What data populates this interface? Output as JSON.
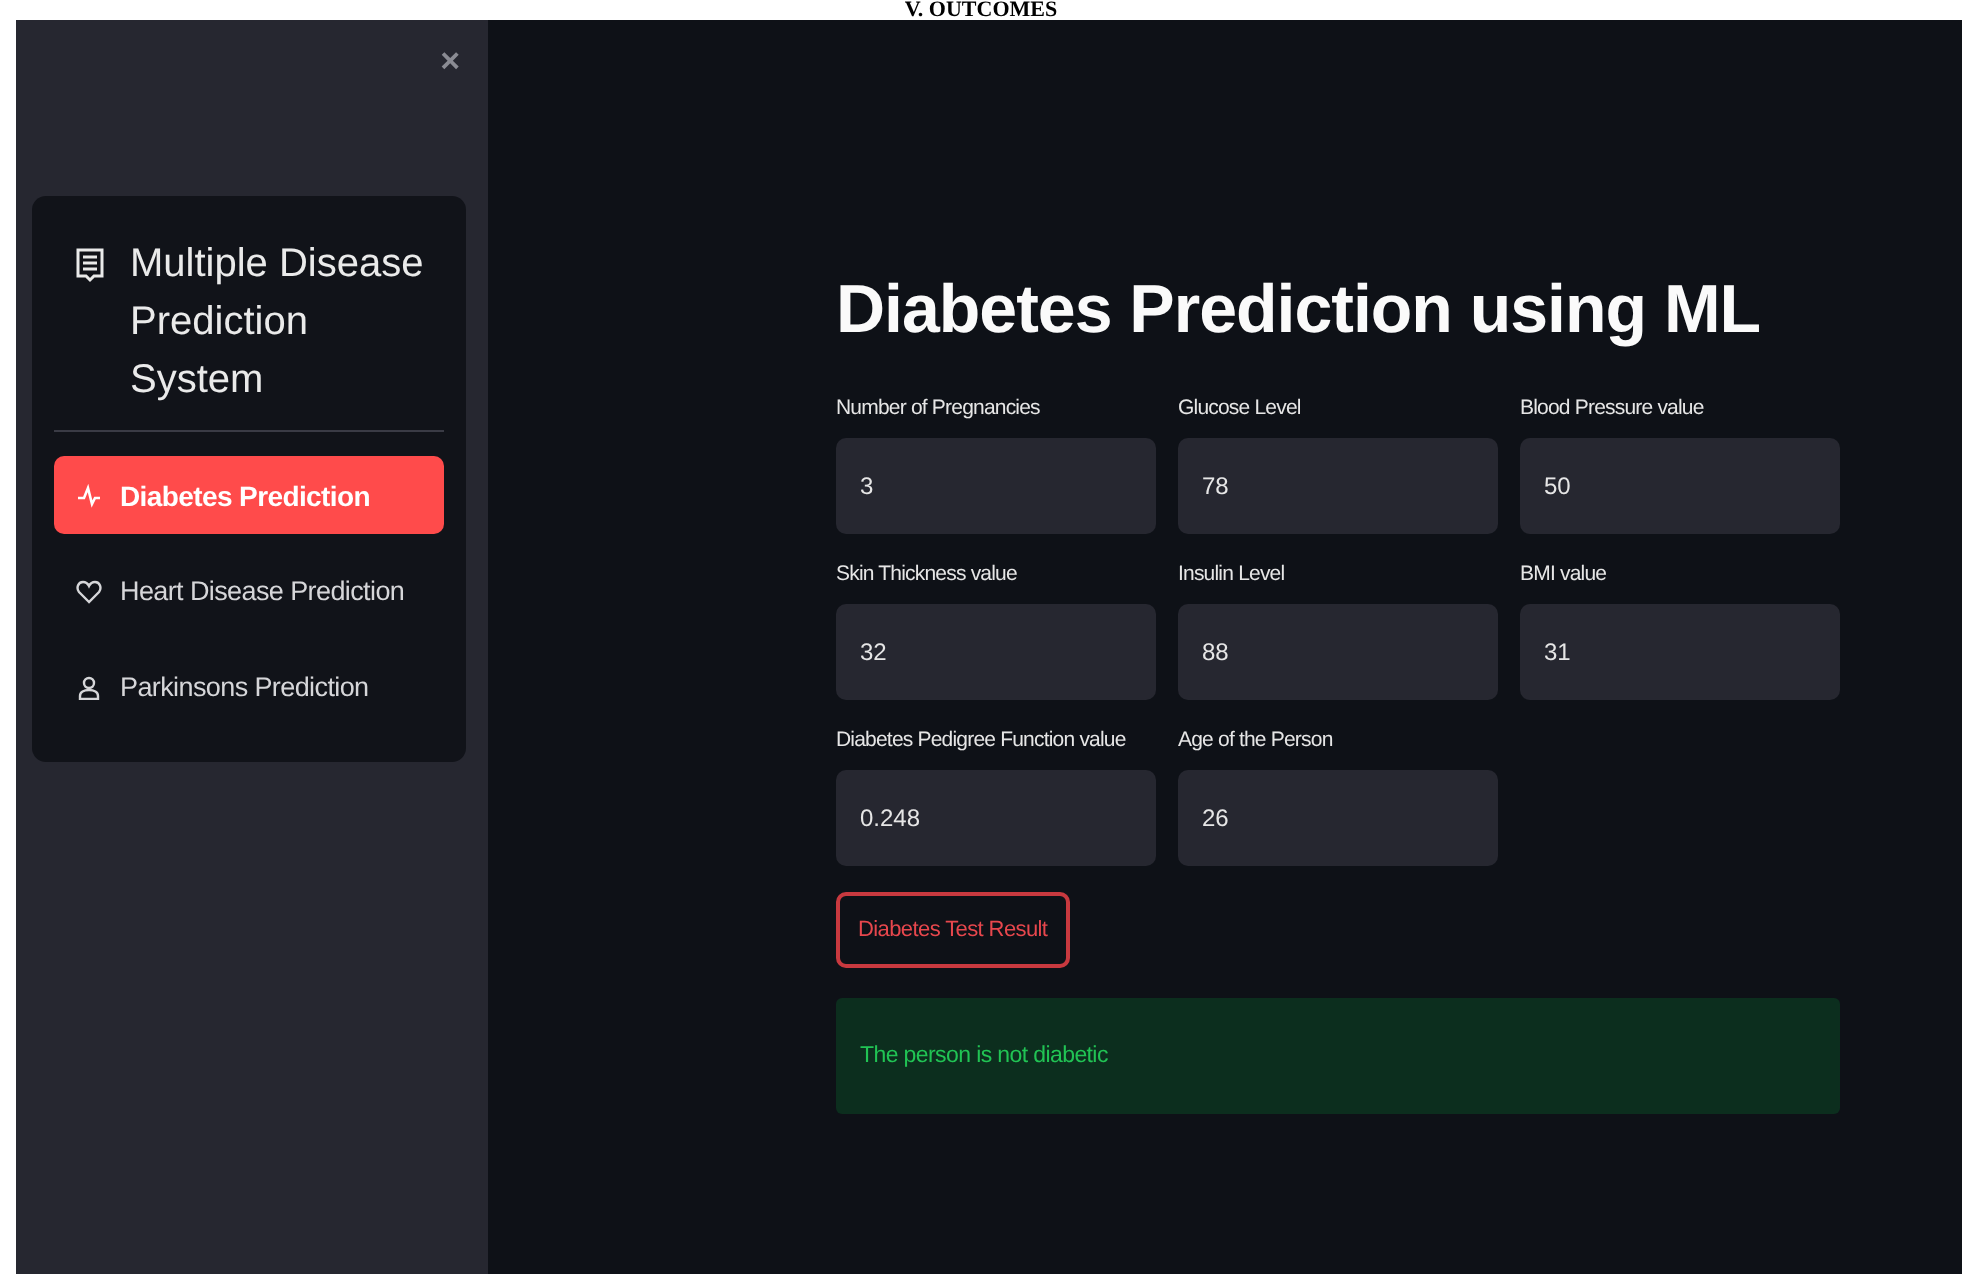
{
  "document_heading": "V. OUTCOMES",
  "sidebar": {
    "close_icon": "×",
    "title": "Multiple Disease Prediction System",
    "items": [
      {
        "label": "Diabetes Prediction",
        "kind": "pulse",
        "selected": true
      },
      {
        "label": "Heart Disease Prediction",
        "kind": "heart",
        "selected": false
      },
      {
        "label": "Parkinsons Prediction",
        "kind": "person",
        "selected": false
      }
    ]
  },
  "main": {
    "title": "Diabetes Prediction using ML",
    "fields": [
      {
        "label": "Number of Pregnancies",
        "value": "3"
      },
      {
        "label": "Glucose Level",
        "value": "78"
      },
      {
        "label": "Blood Pressure value",
        "value": "50"
      },
      {
        "label": "Skin Thickness value",
        "value": "32"
      },
      {
        "label": "Insulin Level",
        "value": "88"
      },
      {
        "label": "BMI value",
        "value": "31"
      },
      {
        "label": "Diabetes Pedigree Function value",
        "value": "0.248"
      },
      {
        "label": "Age of the Person",
        "value": "26"
      }
    ],
    "button": "Diabetes Test Result",
    "result": "The person is not diabetic"
  }
}
